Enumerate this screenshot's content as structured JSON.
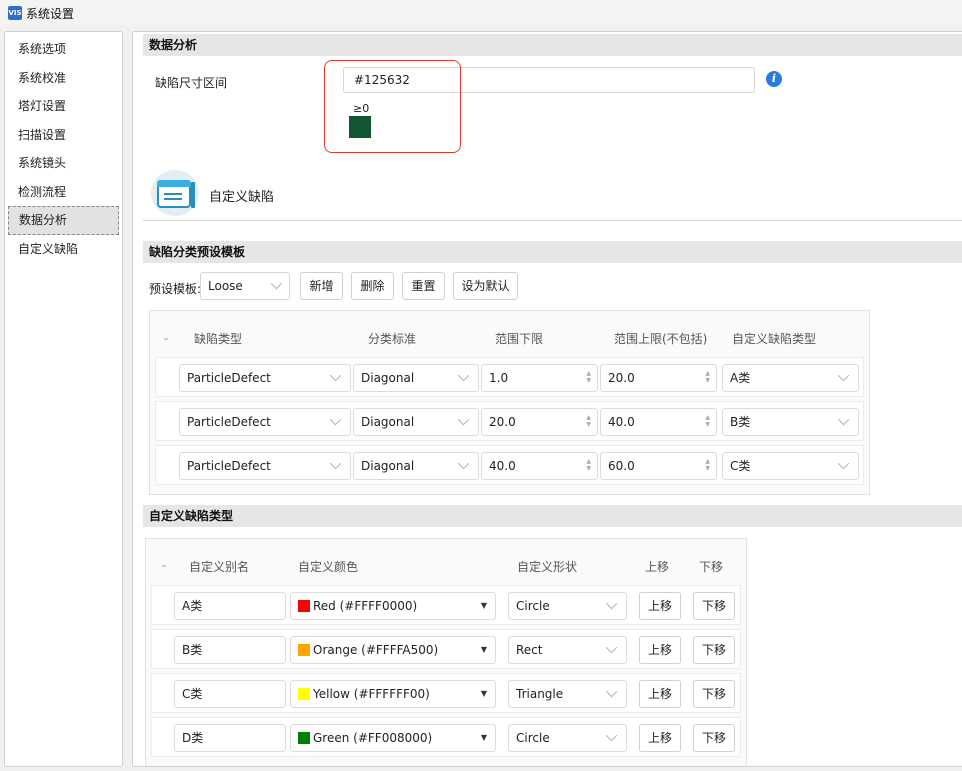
{
  "window": {
    "title": "系统设置",
    "icon_text": "VIS"
  },
  "sidebar": {
    "items": [
      {
        "label": "系统选项"
      },
      {
        "label": "系统校准"
      },
      {
        "label": "塔灯设置"
      },
      {
        "label": "扫描设置"
      },
      {
        "label": "系统镜头"
      },
      {
        "label": "检测流程"
      },
      {
        "label": "数据分析",
        "active": true
      },
      {
        "label": "自定义缺陷"
      }
    ]
  },
  "analysis": {
    "header": "数据分析",
    "range_label": "缺陷尺寸区间",
    "color_value": "#125632",
    "range_min": "≥0",
    "swatch_color": "#125632",
    "info_icon": "info-icon"
  },
  "custom_defect": {
    "title": "自定义缺陷"
  },
  "template_section": {
    "header": "缺陷分类预设模板",
    "preset_label": "预设模板:",
    "preset_value": "Loose",
    "buttons": {
      "add": "新增",
      "delete": "删除",
      "reset": "重置",
      "set_default": "设为默认"
    },
    "columns": [
      "缺陷类型",
      "分类标准",
      "范围下限",
      "范围上限(不包括)",
      "自定义缺陷类型"
    ],
    "rows": [
      {
        "type": "ParticleDefect",
        "standard": "Diagonal",
        "lower": "1.0",
        "upper": "20.0",
        "custom": "A类"
      },
      {
        "type": "ParticleDefect",
        "standard": "Diagonal",
        "lower": "20.0",
        "upper": "40.0",
        "custom": "B类"
      },
      {
        "type": "ParticleDefect",
        "standard": "Diagonal",
        "lower": "40.0",
        "upper": "60.0",
        "custom": "C类"
      }
    ]
  },
  "custom_types": {
    "header": "自定义缺陷类型",
    "columns": [
      "自定义别名",
      "自定义颜色",
      "自定义形状",
      "上移",
      "下移"
    ],
    "up_label": "上移",
    "down_label": "下移",
    "rows": [
      {
        "alias": "A类",
        "color_label": "Red (#FFFF0000)",
        "color": "#ff0000",
        "shape": "Circle"
      },
      {
        "alias": "B类",
        "color_label": "Orange (#FFFFA500)",
        "color": "#ffa500",
        "shape": "Rect"
      },
      {
        "alias": "C类",
        "color_label": "Yellow (#FFFFFF00)",
        "color": "#ffff00",
        "shape": "Triangle"
      },
      {
        "alias": "D类",
        "color_label": "Green (#FF008000)",
        "color": "#008000",
        "shape": "Circle"
      }
    ]
  }
}
